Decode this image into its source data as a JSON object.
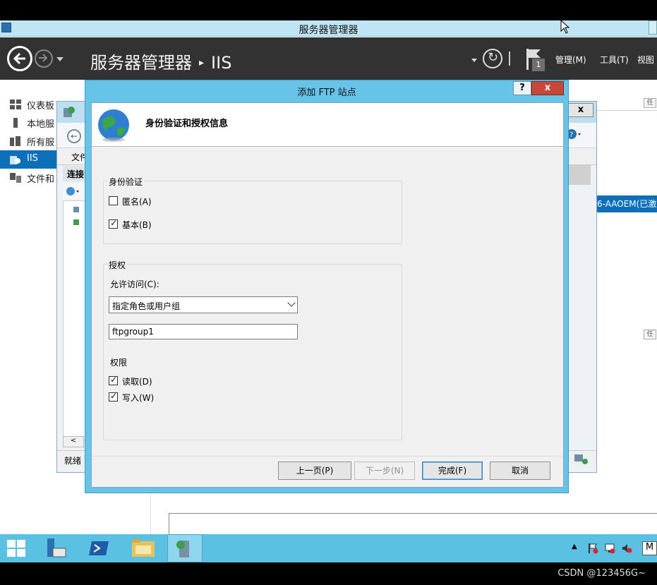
{
  "server_manager": {
    "window_title": "服务器管理器",
    "breadcrumb_root": "服务器管理器",
    "breadcrumb_sep": "▸",
    "breadcrumb_current": "IIS",
    "flag_count": "1",
    "menu_manage": "管理(M)",
    "menu_tools": "工具(T)",
    "menu_view": "视图",
    "sidebar": {
      "items": [
        {
          "label": "仪表板",
          "icon": "dashboard-icon"
        },
        {
          "label": "本地服",
          "icon": "local-server-icon"
        },
        {
          "label": "所有服",
          "icon": "all-servers-icon"
        },
        {
          "label": "IIS",
          "icon": "iis-icon",
          "active": true
        },
        {
          "label": "文件和",
          "icon": "file-storage-icon"
        }
      ]
    },
    "right_row_text": "6-AAOEM(已激",
    "mini_label": "任"
  },
  "iis_manager": {
    "close": "x",
    "menu_file": "文件",
    "connections": "连接",
    "status": "就绪"
  },
  "dialog": {
    "title": "添加 FTP 站点",
    "help": "?",
    "close": "x",
    "section_title": "身份验证和授权信息",
    "authentication": {
      "label": "身份验证",
      "anonymous": {
        "label": "匿名(A)",
        "checked": false
      },
      "basic": {
        "label": "基本(B)",
        "checked": true
      }
    },
    "authorization": {
      "label": "授权",
      "allow_access_label": "允许访问(C):",
      "allow_access_value": "指定角色或用户组",
      "user_group_value": "ftpgroup1",
      "permissions_label": "权限",
      "read": {
        "label": "读取(D)",
        "checked": true
      },
      "write": {
        "label": "写入(W)",
        "checked": true
      }
    },
    "buttons": {
      "prev": "上一页(P)",
      "next": "下一步(N)",
      "finish": "完成(F)",
      "cancel": "取消"
    }
  },
  "taskbar": {
    "tray_ime": "M"
  },
  "watermark": "CSDN @123456G~",
  "colors": {
    "sm_header": "#323232",
    "accent_blue": "#0d6fb8",
    "dialog_frame": "#67c3e8",
    "taskbar": "#5ac1e3",
    "close_red": "#c7473a"
  }
}
